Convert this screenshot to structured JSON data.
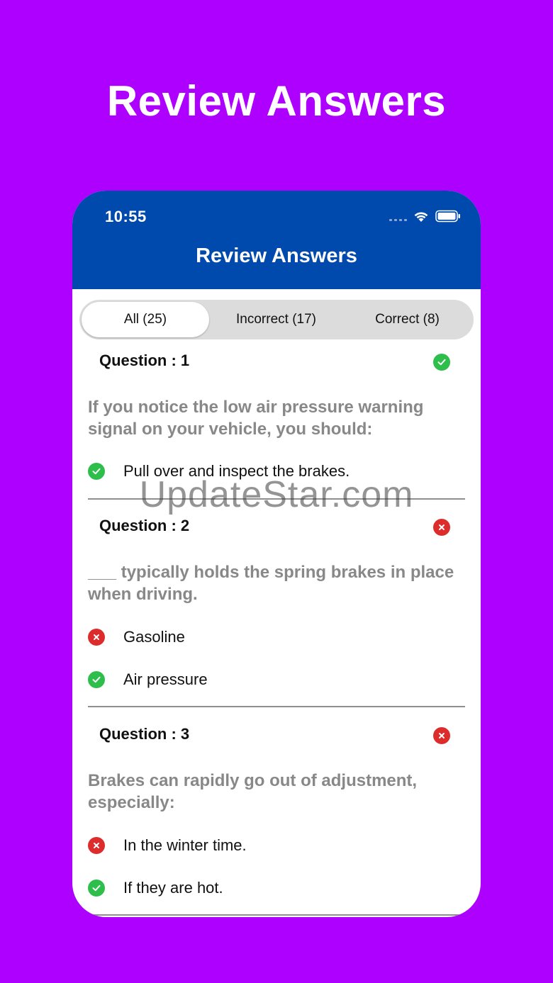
{
  "promo": {
    "title": "Review Answers"
  },
  "status_bar": {
    "time": "10:55"
  },
  "nav": {
    "title": "Review Answers"
  },
  "tabs": [
    {
      "label": "All (25)",
      "active": true
    },
    {
      "label": "Incorrect (17)",
      "active": false
    },
    {
      "label": "Correct (8)",
      "active": false
    }
  ],
  "questions": [
    {
      "title": "Question : 1",
      "status": "correct",
      "text": "If you notice the low air pressure warning signal on your vehicle, you should:",
      "answers": [
        {
          "label": "Pull over and inspect the brakes.",
          "mark": "correct"
        }
      ]
    },
    {
      "title": "Question : 2",
      "status": "incorrect",
      "text": "___ typically holds the spring brakes in place when driving.",
      "answers": [
        {
          "label": "Gasoline",
          "mark": "incorrect"
        },
        {
          "label": "Air pressure",
          "mark": "correct"
        }
      ]
    },
    {
      "title": "Question : 3",
      "status": "incorrect",
      "text": "Brakes can rapidly go out of adjustment, especially:",
      "answers": [
        {
          "label": "In the winter time.",
          "mark": "incorrect"
        },
        {
          "label": "If they are hot.",
          "mark": "correct"
        }
      ]
    }
  ],
  "watermark": "UpdateStar.com",
  "colors": {
    "background": "#AE00FF",
    "header": "#004AAD",
    "correct": "#2DBE4C",
    "incorrect": "#DC2C2C"
  }
}
